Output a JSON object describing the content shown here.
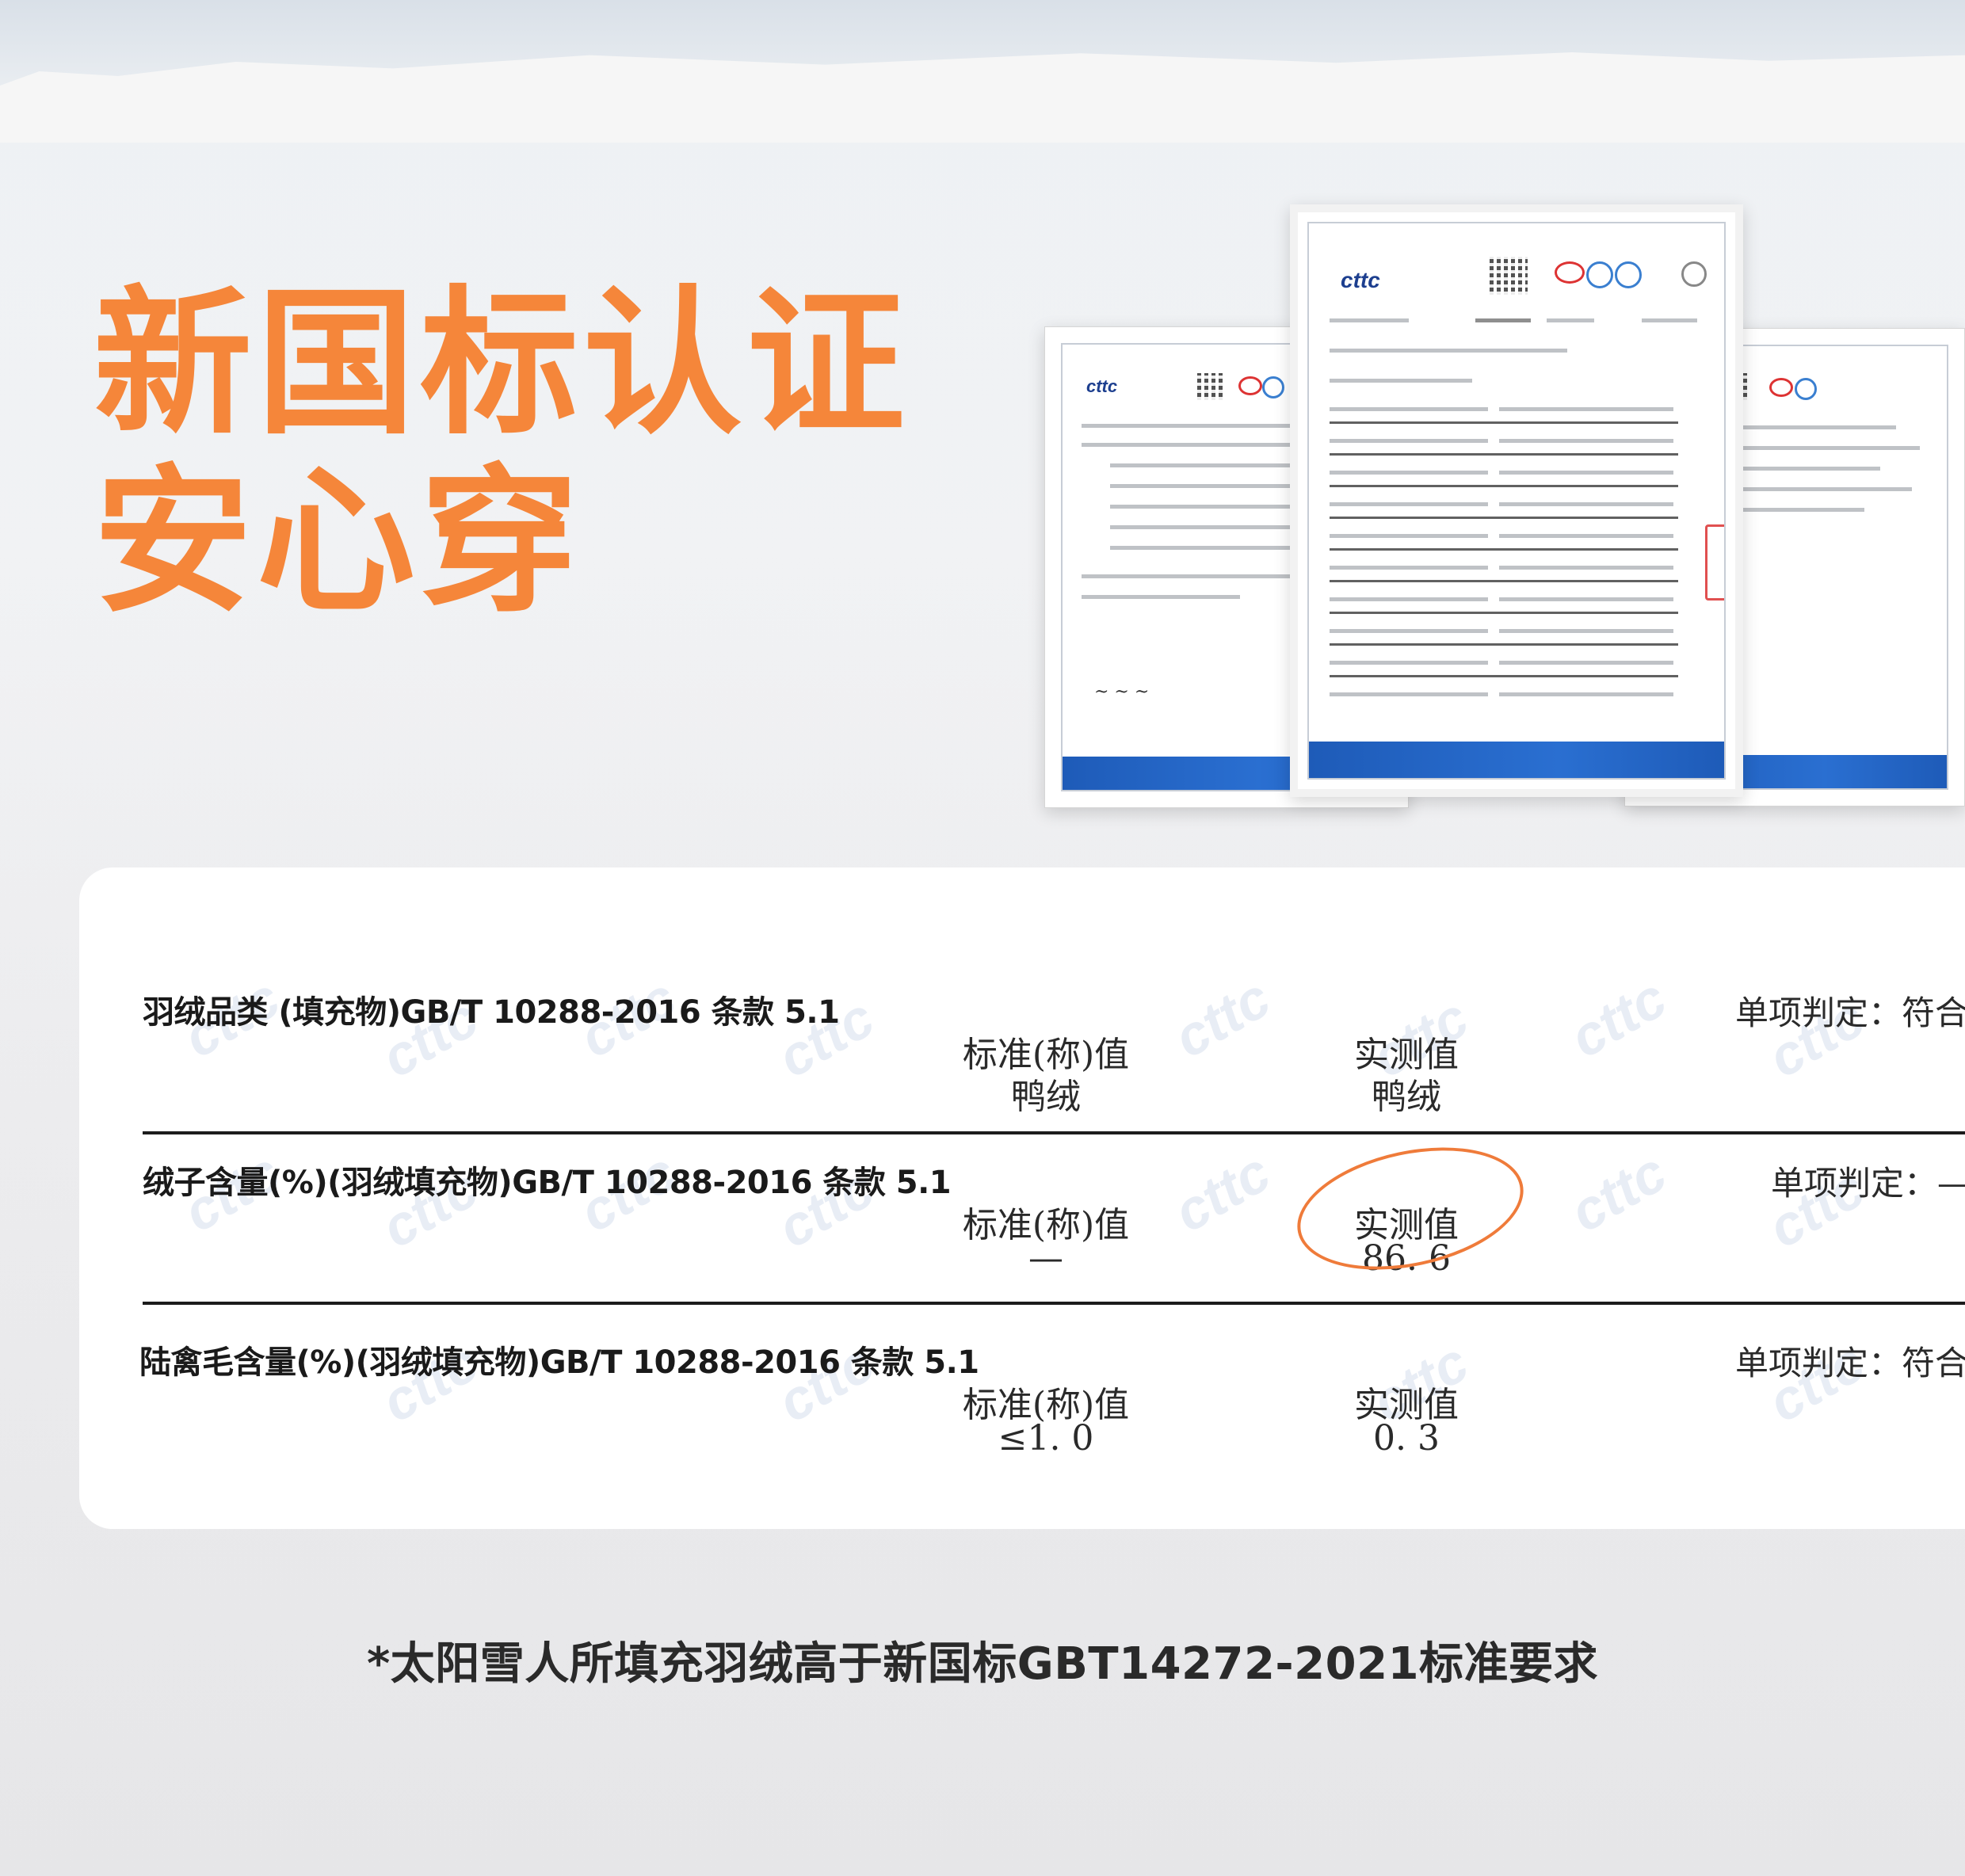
{
  "headline": {
    "line1": "新国标认证",
    "line2": "安心穿"
  },
  "documents": {
    "logo": "cttc"
  },
  "results": [
    {
      "title": "羽绒品类 (填充物)GB/T 10288-2016  条款 5.1",
      "verdict_label": "单项判定：",
      "verdict_value": "符合",
      "standard_label": "标准(称)值",
      "standard_value": "鸭绒",
      "actual_label": "实测值",
      "actual_value": "鸭绒"
    },
    {
      "title": "绒子含量(%)(羽绒填充物)GB/T 10288-2016  条款 5.1",
      "verdict_label": "单项判定：",
      "verdict_value": "—",
      "standard_label": "标准(称)值",
      "standard_value": "—",
      "actual_label": "实测值",
      "actual_value": "86. 6",
      "highlighted": true
    },
    {
      "title": "陆禽毛含量(%)(羽绒填充物)GB/T 10288-2016  条款 5.1",
      "verdict_label": "单项判定：",
      "verdict_value": "符合",
      "standard_label": "标准(称)值",
      "standard_value": "≤1. 0",
      "actual_label": "实测值",
      "actual_value": "0. 3"
    }
  ],
  "footnote": "*太阳雪人所填充羽绒高于新国标GBT14272-2021标准要求",
  "colors": {
    "accent": "#f5863a",
    "highlight_circle": "#ef7b3a",
    "doc_footer": "#1e5bb8"
  }
}
